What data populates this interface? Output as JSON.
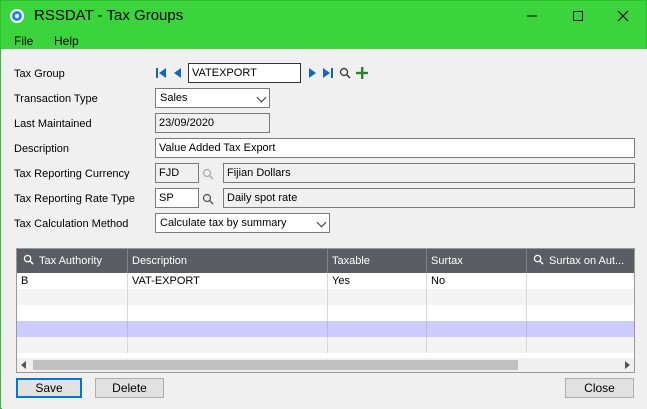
{
  "window": {
    "title": "RSSDAT - Tax Groups",
    "minimize_icon": "minimize-icon",
    "maximize_icon": "maximize-icon",
    "close_icon": "close-icon"
  },
  "menu": {
    "file": "File",
    "help": "Help"
  },
  "form": {
    "tax_group_label": "Tax Group",
    "tax_group_value": "VATEXPORT",
    "transaction_type_label": "Transaction Type",
    "transaction_type_value": "Sales",
    "last_maintained_label": "Last Maintained",
    "last_maintained_value": "23/09/2020",
    "description_label": "Description",
    "description_value": "Value Added Tax Export",
    "reporting_currency_label": "Tax Reporting Currency",
    "reporting_currency_code": "FJD",
    "reporting_currency_desc": "Fijian Dollars",
    "reporting_rate_type_label": "Tax Reporting Rate Type",
    "reporting_rate_type_code": "SP",
    "reporting_rate_type_desc": "Daily spot rate",
    "calc_method_label": "Tax Calculation Method",
    "calc_method_value": "Calculate tax by summary"
  },
  "grid": {
    "headers": [
      "Tax Authority",
      "Description",
      "Taxable",
      "Surtax",
      "Surtax on Aut..."
    ],
    "rows": [
      [
        "B",
        "VAT-EXPORT",
        "Yes",
        "No",
        ""
      ]
    ]
  },
  "buttons": {
    "save": "Save",
    "delete": "Delete",
    "close": "Close"
  },
  "colors": {
    "titlebar": "#3cd43c",
    "grid_header": "#5a5d63",
    "selected_row": "#ccccff"
  }
}
